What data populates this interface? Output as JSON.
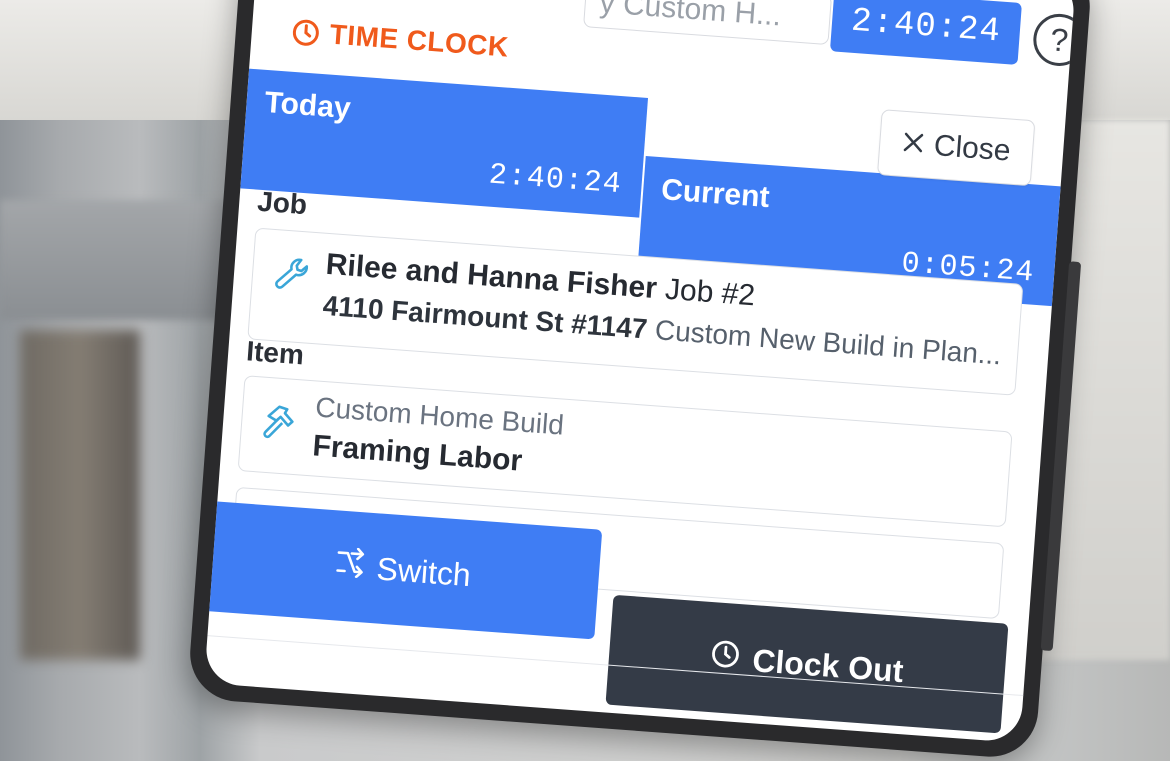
{
  "topbar": {
    "search_text": "y Custom H...",
    "timer": "2:40:24",
    "help_symbol": "?"
  },
  "brand": {
    "title": "TIME CLOCK",
    "icon": "clock-icon",
    "color": "#f05a1c"
  },
  "header": {
    "today_label": "Today",
    "today_time": "2:40:24",
    "current_label": "Current",
    "current_time": "0:05:24",
    "close_label": "Close",
    "accent": "#3f7df4"
  },
  "job": {
    "section_label": "Job",
    "client_name": "Rilee and Hanna Fisher",
    "job_number": "Job #2",
    "address": "4110 Fairmount St #1147",
    "description": "Custom New Build in Plan...",
    "icon": "wrench-icon"
  },
  "item": {
    "section_label": "Item",
    "category": "Custom Home Build",
    "name": "Framing Labor",
    "icon": "hammer-icon"
  },
  "actions": {
    "switch_label": "Switch",
    "clock_out_label": "Clock Out",
    "clock_out_color": "#343b47"
  }
}
